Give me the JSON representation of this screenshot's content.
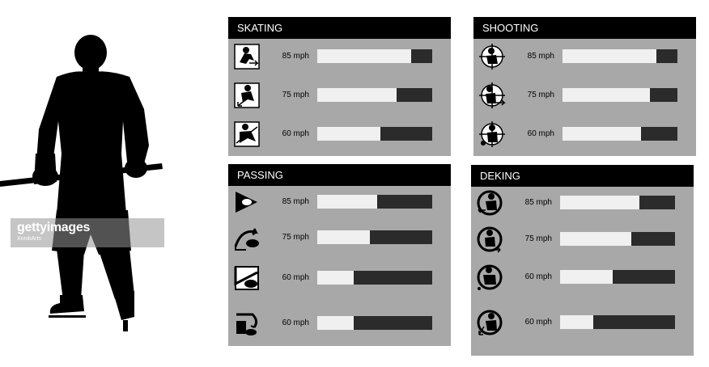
{
  "watermark": {
    "logo_text": "gettyimages",
    "credit": "XonikArts"
  },
  "panels": [
    {
      "title": "SKATING",
      "rows": [
        {
          "icon": "skater-forward-icon",
          "speed": "85 mph",
          "level": 0.82
        },
        {
          "icon": "skater-crossover-icon",
          "speed": "75 mph",
          "level": 0.69
        },
        {
          "icon": "skater-backward-icon",
          "speed": "60 mph",
          "level": 0.55
        }
      ]
    },
    {
      "title": "SHOOTING",
      "rows": [
        {
          "icon": "slapshot-target-icon",
          "speed": "85 mph",
          "level": 0.82
        },
        {
          "icon": "wristshot-target-icon",
          "speed": "75 mph",
          "level": 0.76
        },
        {
          "icon": "snapshot-target-icon",
          "speed": "60 mph",
          "level": 0.68
        }
      ]
    },
    {
      "title": "PASSING",
      "rows": [
        {
          "icon": "puck-pass-icon",
          "speed": "85 mph",
          "level": 0.52
        },
        {
          "icon": "saucer-pass-icon",
          "speed": "75 mph",
          "level": 0.46
        },
        {
          "icon": "bank-pass-icon",
          "speed": "60 mph",
          "level": 0.32
        },
        {
          "icon": "drop-pass-icon",
          "speed": "60 mph",
          "level": 0.32
        }
      ]
    },
    {
      "title": "DEKING",
      "rows": [
        {
          "icon": "deke-left-icon",
          "speed": "85 mph",
          "level": 0.69
        },
        {
          "icon": "deke-spin-icon",
          "speed": "75 mph",
          "level": 0.62
        },
        {
          "icon": "deke-between-legs-icon",
          "speed": "60 mph",
          "level": 0.46
        },
        {
          "icon": "deke-backhand-icon",
          "speed": "60 mph",
          "level": 0.29
        }
      ]
    }
  ],
  "colors": {
    "panel_bg": "#a8a8a8",
    "header_bg": "#000000",
    "bar_track": "#2b2b2b",
    "bar_fill": "#f0f0f0"
  }
}
